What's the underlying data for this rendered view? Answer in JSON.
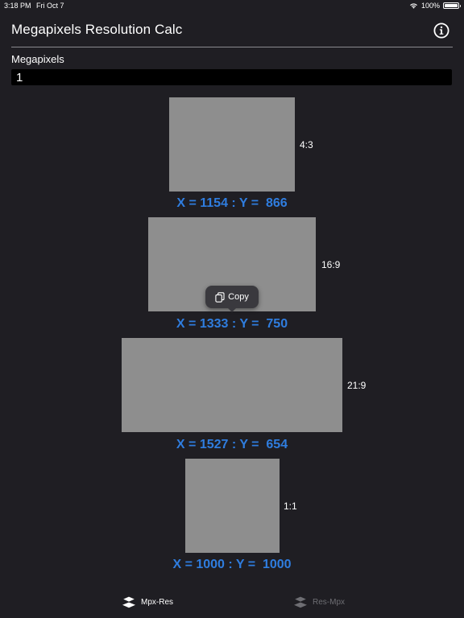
{
  "status_bar": {
    "time": "3:18 PM",
    "date": "Fri Oct 7",
    "battery": "100%",
    "battery_level": 1.0
  },
  "nav": {
    "title": "Megapixels Resolution Calc",
    "info_icon": "info-circle-icon"
  },
  "input": {
    "label": "Megapixels",
    "value": "1"
  },
  "ratios": [
    {
      "label": "4:3",
      "result": "X = 1154 : Y =  866"
    },
    {
      "label": "16:9",
      "result": "X = 1333 : Y =  750"
    },
    {
      "label": "21:9",
      "result": "X = 1527 : Y =  654"
    },
    {
      "label": "1:1",
      "result": "X = 1000 : Y =  1000"
    }
  ],
  "popup": {
    "label": "Copy",
    "icon": "copy-icon"
  },
  "tabs": [
    {
      "label": "Mpx-Res",
      "icon": "layers-icon",
      "active": true
    },
    {
      "label": "Res-Mpx",
      "icon": "layers-icon",
      "active": false
    }
  ],
  "colors": {
    "background": "#1f1e23",
    "accent": "#2f7ddf",
    "box": "#8e8e8e",
    "input_bg": "#000000"
  }
}
